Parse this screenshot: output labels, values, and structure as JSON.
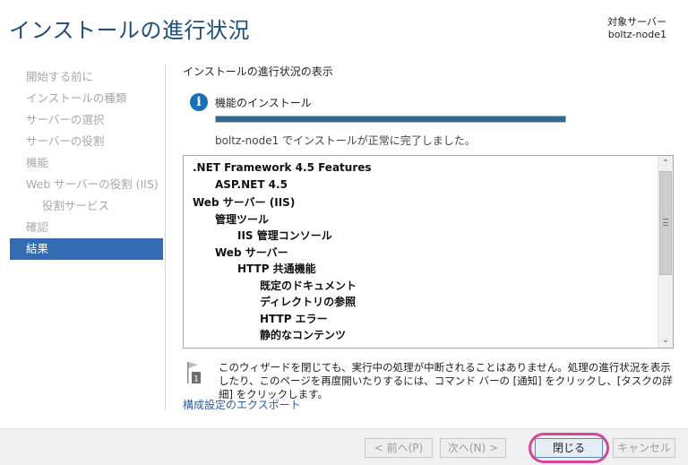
{
  "window": {
    "title": "インストールの進行状況",
    "target_server_label": "対象サーバー",
    "target_server_name": "boltz-node1"
  },
  "sidebar": {
    "items": [
      {
        "label": "開始する前に",
        "state": "disabled"
      },
      {
        "label": "インストールの種類",
        "state": "disabled"
      },
      {
        "label": "サーバーの選択",
        "state": "disabled"
      },
      {
        "label": "サーバーの役割",
        "state": "disabled"
      },
      {
        "label": "機能",
        "state": "disabled"
      },
      {
        "label": "Web サーバーの役割 (IIS)",
        "state": "disabled"
      },
      {
        "label": "役割サービス",
        "state": "disabled"
      },
      {
        "label": "確認",
        "state": "disabled"
      },
      {
        "label": "結果",
        "state": "active"
      }
    ]
  },
  "main": {
    "section_header": "インストールの進行状況の表示",
    "status": {
      "icon": "info-icon",
      "title": "機能のインストール",
      "progress_percent": 100,
      "message": "boltz-node1 でインストールが正常に完了しました。"
    },
    "results": [
      {
        "label": ".NET Framework 4.5 Features",
        "level": 1
      },
      {
        "label": "ASP.NET 4.5",
        "level": 2
      },
      {
        "label": "Web サーバー (IIS)",
        "level": 1
      },
      {
        "label": "管理ツール",
        "level": 2
      },
      {
        "label": "IIS 管理コンソール",
        "level": 3
      },
      {
        "label": "Web サーバー",
        "level": 2
      },
      {
        "label": "HTTP 共通機能",
        "level": 3
      },
      {
        "label": "既定のドキュメント",
        "level": 4
      },
      {
        "label": "ディレクトリの参照",
        "level": 4
      },
      {
        "label": "HTTP エラー",
        "level": 4
      },
      {
        "label": "静的なコンテンツ",
        "level": 4
      }
    ],
    "note": {
      "icon": "flag-icon",
      "badge": "1",
      "text": "このウィザードを閉じても、実行中の処理が中断されることはありません。処理の進行状況を表示したり、このページを再度開いたりするには、コマンド バーの [通知] をクリックし、[タスクの詳細] をクリックします。"
    },
    "export_link": "構成設定のエクスポート"
  },
  "footer": {
    "prev_label": "< 前へ(P)",
    "next_label": "次へ(N) >",
    "close_label": "閉じる",
    "cancel_label": "キャンセル"
  },
  "colors": {
    "title": "#1f4e79",
    "active_nav": "#336cb3",
    "progress": "#306a93",
    "highlight": "#d2489a",
    "link": "#2a5da8"
  }
}
